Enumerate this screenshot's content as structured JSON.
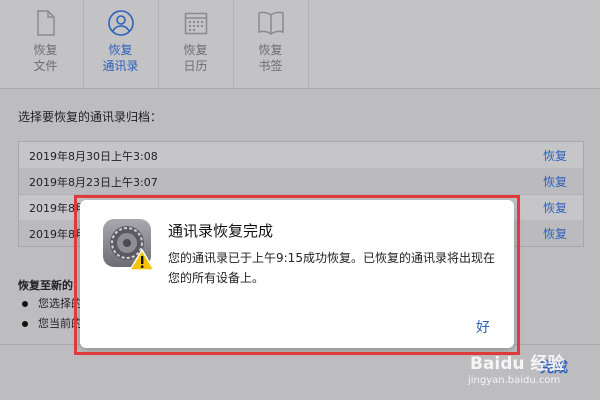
{
  "toolbar": {
    "tabs": [
      {
        "label1": "恢复",
        "label2": "文件",
        "icon": "file-icon"
      },
      {
        "label1": "恢复",
        "label2": "通讯录",
        "icon": "contact-icon"
      },
      {
        "label1": "恢复",
        "label2": "日历",
        "icon": "calendar-icon"
      },
      {
        "label1": "恢复",
        "label2": "书签",
        "icon": "bookmark-icon"
      }
    ]
  },
  "archive_section": {
    "title": "选择要恢复的通讯录归档：",
    "rows": [
      {
        "date": "2019年8月30日上午3:08",
        "action": "恢复"
      },
      {
        "date": "2019年8月23日上午3:07",
        "action": "恢复"
      },
      {
        "date": "2019年8月",
        "action": "恢复"
      },
      {
        "date": "2019年8月",
        "action": "恢复"
      }
    ]
  },
  "restore_info": {
    "title": "恢复至新的",
    "bullets": [
      "您选择的",
      "您当前的"
    ]
  },
  "footer": {
    "done_label": "完成"
  },
  "dialog": {
    "title": "通讯录恢复完成",
    "message": "您的通讯录已于上午9:15成功恢复。已恢复的通讯录将出现在您的所有设备上。",
    "ok_label": "好",
    "icon": "settings-warning-icon"
  },
  "watermark": {
    "brand": "Baidu 经验",
    "url": "jingyan.baidu.com"
  },
  "colors": {
    "accent": "#2e62b8",
    "highlight": "#e03b3b"
  }
}
